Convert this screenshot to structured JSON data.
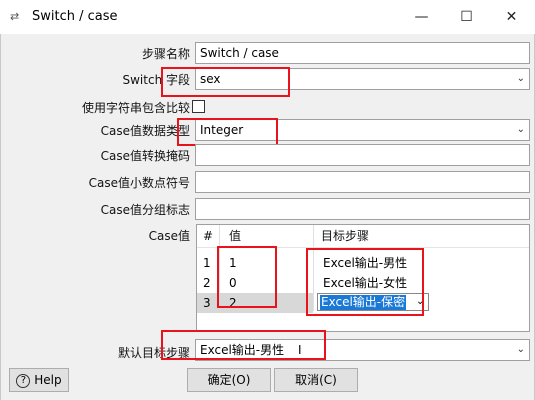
{
  "window": {
    "title": "Switch / case",
    "minimize_icon": "minimize-icon",
    "maximize_icon": "maximize-icon",
    "close_icon": "close-icon"
  },
  "form": {
    "step_name_label": "步骤名称",
    "step_name_value": "Switch / case",
    "switch_field_label": "Switch 字段",
    "switch_field_value": "sex",
    "use_string_contains_label": "使用字符串包含比较",
    "use_string_contains_checked": false,
    "case_type_label": "Case值数据类型",
    "case_type_value": "Integer",
    "case_mask_label": "Case值转换掩码",
    "case_mask_value": "",
    "case_decimal_label": "Case值小数点符号",
    "case_decimal_value": "",
    "case_group_label": "Case值分组标志",
    "case_group_value": "",
    "case_values_label": "Case值",
    "default_target_label": "默认目标步骤",
    "default_target_value": "Excel输出-男性"
  },
  "case_table": {
    "headers": [
      "#",
      "值",
      "目标步骤"
    ],
    "rows": [
      {
        "num": "1",
        "value": "1",
        "target": "Excel输出-男性"
      },
      {
        "num": "2",
        "value": "0",
        "target": "Excel输出-女性"
      },
      {
        "num": "3",
        "value": "2",
        "target": "Excel输出-保密"
      }
    ]
  },
  "buttons": {
    "help": "Help",
    "ok": "确定(O)",
    "cancel": "取消(C)"
  },
  "colors": {
    "highlight_red": "#e8141b",
    "selection_blue": "#1a78d6"
  }
}
